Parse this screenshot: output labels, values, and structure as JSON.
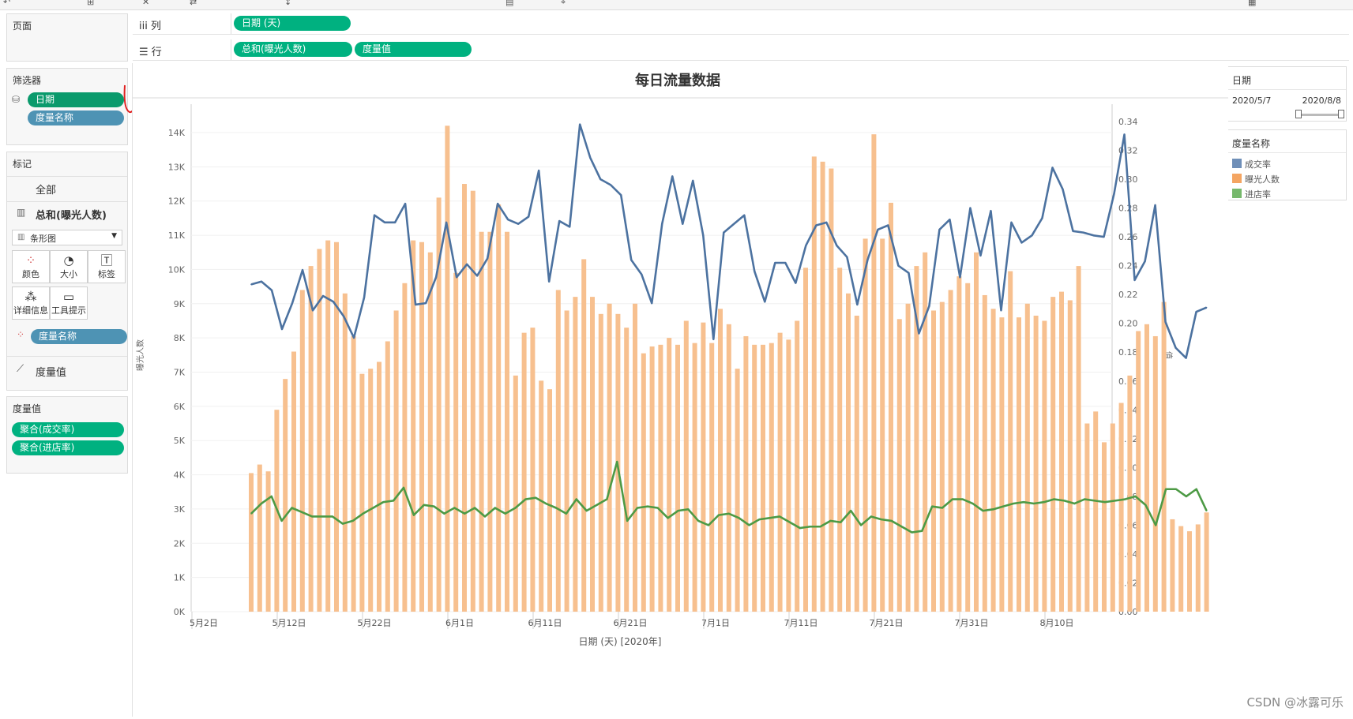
{
  "shelves": {
    "pages": {
      "label": "页面"
    },
    "columns": {
      "label": "列",
      "pills": [
        "日期 (天)"
      ]
    },
    "rows": {
      "label": "行",
      "pills": [
        "总和(曝光人数)",
        "度量值"
      ]
    }
  },
  "filters": {
    "title": "筛选器",
    "pills": [
      "日期",
      "度量名称"
    ]
  },
  "marks": {
    "title": "标记",
    "all_label": "全部",
    "bar_label": "总和(曝光人数)",
    "mark_type": "条形图",
    "buttons": {
      "color": "颜色",
      "size": "大小",
      "label": "标签",
      "detail": "详细信息",
      "tooltip": "工具提示"
    },
    "color_pill": "度量名称",
    "line_label": "度量值"
  },
  "measure_values": {
    "title": "度量值",
    "pills": [
      "聚合(成交率)",
      "聚合(进店率)"
    ]
  },
  "date_filter": {
    "title": "日期",
    "start": "2020/5/7",
    "end": "2020/8/8",
    "slider_start": 0.0,
    "slider_end": 1.0
  },
  "legend": {
    "title": "度量名称",
    "items": [
      {
        "name": "成交率",
        "color": "#6f8fb8"
      },
      {
        "name": "曝光人数",
        "color": "#f4a562"
      },
      {
        "name": "进店率",
        "color": "#76b86c"
      }
    ]
  },
  "watermark": "CSDN @冰露可乐",
  "colors": {
    "bar": "#f7c08f",
    "line_conv": "#4c72a0",
    "line_store": "#4d9a45",
    "pill_green": "#00b180",
    "pill_blue": "#4e93b4"
  },
  "chart_data": {
    "type": "bar",
    "title": "每日流量数据",
    "xlabel": "日期 (天) [2020年]",
    "ylabel_left": "曝光人数",
    "ylabel_right": "值",
    "x_start": "2020-05-07",
    "x_end": "2020-08-08",
    "x_ticks": [
      "5月2日",
      "5月12日",
      "5月22日",
      "6月1日",
      "6月11日",
      "6月21日",
      "7月1日",
      "7月11日",
      "7月21日",
      "7月31日",
      "8月10日"
    ],
    "y_left": {
      "ticks": [
        "0K",
        "1K",
        "2K",
        "3K",
        "4K",
        "5K",
        "6K",
        "7K",
        "8K",
        "9K",
        "10K",
        "11K",
        "12K",
        "13K",
        "14K"
      ],
      "ylim": [
        0,
        14000
      ]
    },
    "y_right": {
      "ticks": [
        "0.00",
        "0.02",
        "0.04",
        "0.06",
        "0.08",
        "0.10",
        "0.12",
        "0.14",
        "0.16",
        "0.18",
        "0.20",
        "0.22",
        "0.24",
        "0.26",
        "0.28",
        "0.30",
        "0.32",
        "0.34"
      ],
      "ylim": [
        0,
        0.34
      ]
    },
    "series": [
      {
        "name": "曝光人数",
        "axis": "left",
        "kind": "bar",
        "values": [
          4050,
          4300,
          4100,
          5900,
          6800,
          7600,
          9400,
          10100,
          10600,
          10850,
          10800,
          9300,
          8050,
          6950,
          7100,
          7300,
          7900,
          8800,
          9600,
          10850,
          10800,
          10500,
          12100,
          14200,
          9900,
          12500,
          12300,
          11100,
          11100,
          11900,
          11100,
          6900,
          8150,
          8300,
          6750,
          6500,
          9400,
          8800,
          9200,
          10300,
          9200,
          8700,
          9000,
          8700,
          8300,
          9000,
          7550,
          7750,
          7800,
          8000,
          7800,
          8500,
          7850,
          8450,
          7850,
          8850,
          8400,
          7100,
          8050,
          7800,
          7800,
          7850,
          8150,
          7950,
          8500,
          10050,
          13300,
          13150,
          12950,
          10050,
          9300,
          8650,
          10900,
          13950,
          10900,
          11950,
          8550,
          9000,
          10100,
          10500,
          8800,
          9050,
          9400,
          9800,
          9600,
          10500,
          9250,
          8850,
          8600,
          9950,
          8600,
          9000,
          8650,
          8500,
          9200,
          9350,
          9100,
          10100,
          5500,
          5850,
          4950,
          5500,
          6100,
          6900,
          8200,
          8400,
          8050,
          9050,
          2700,
          2500,
          2350,
          2550,
          2900
        ]
      },
      {
        "name": "成交率",
        "axis": "right",
        "kind": "line",
        "values": [
          0.227,
          0.229,
          0.223,
          0.196,
          0.214,
          0.237,
          0.209,
          0.219,
          0.215,
          0.205,
          0.19,
          0.218,
          0.275,
          0.27,
          0.27,
          0.283,
          0.213,
          0.214,
          0.232,
          0.27,
          0.232,
          0.241,
          0.233,
          0.245,
          0.283,
          0.272,
          0.269,
          0.274,
          0.306,
          0.229,
          0.271,
          0.267,
          0.338,
          0.315,
          0.3,
          0.296,
          0.289,
          0.244,
          0.234,
          0.214,
          0.269,
          0.302,
          0.269,
          0.299,
          0.261,
          0.189,
          0.263,
          0.269,
          0.275,
          0.236,
          0.215,
          0.242,
          0.242,
          0.228,
          0.254,
          0.268,
          0.27,
          0.254,
          0.246,
          0.213,
          0.244,
          0.265,
          0.268,
          0.24,
          0.235,
          0.193,
          0.212,
          0.265,
          0.272,
          0.232,
          0.28,
          0.247,
          0.278,
          0.209,
          0.27,
          0.256,
          0.261,
          0.273,
          0.308,
          0.293,
          0.264,
          0.263,
          0.261,
          0.26,
          0.29,
          0.331,
          0.23,
          0.243,
          0.282,
          0.201,
          0.183,
          0.176,
          0.208,
          0.211
        ]
      },
      {
        "name": "进店率",
        "axis": "right",
        "kind": "line",
        "values": [
          0.068,
          0.075,
          0.08,
          0.063,
          0.072,
          0.069,
          0.066,
          0.066,
          0.066,
          0.061,
          0.063,
          0.068,
          0.072,
          0.076,
          0.077,
          0.086,
          0.067,
          0.074,
          0.073,
          0.068,
          0.072,
          0.068,
          0.072,
          0.066,
          0.072,
          0.068,
          0.072,
          0.078,
          0.079,
          0.075,
          0.072,
          0.068,
          0.078,
          0.07,
          0.074,
          0.078,
          0.104,
          0.063,
          0.072,
          0.073,
          0.072,
          0.065,
          0.07,
          0.071,
          0.063,
          0.06,
          0.067,
          0.068,
          0.065,
          0.06,
          0.064,
          0.065,
          0.066,
          0.062,
          0.058,
          0.059,
          0.059,
          0.063,
          0.062,
          0.07,
          0.06,
          0.066,
          0.064,
          0.063,
          0.059,
          0.055,
          0.056,
          0.073,
          0.072,
          0.078,
          0.078,
          0.075,
          0.07,
          0.071,
          0.073,
          0.075,
          0.076,
          0.075,
          0.076,
          0.078,
          0.077,
          0.075,
          0.078,
          0.077,
          0.076,
          0.077,
          0.078,
          0.08,
          0.074,
          0.06,
          0.085,
          0.085,
          0.08,
          0.085,
          0.07
        ]
      }
    ]
  }
}
